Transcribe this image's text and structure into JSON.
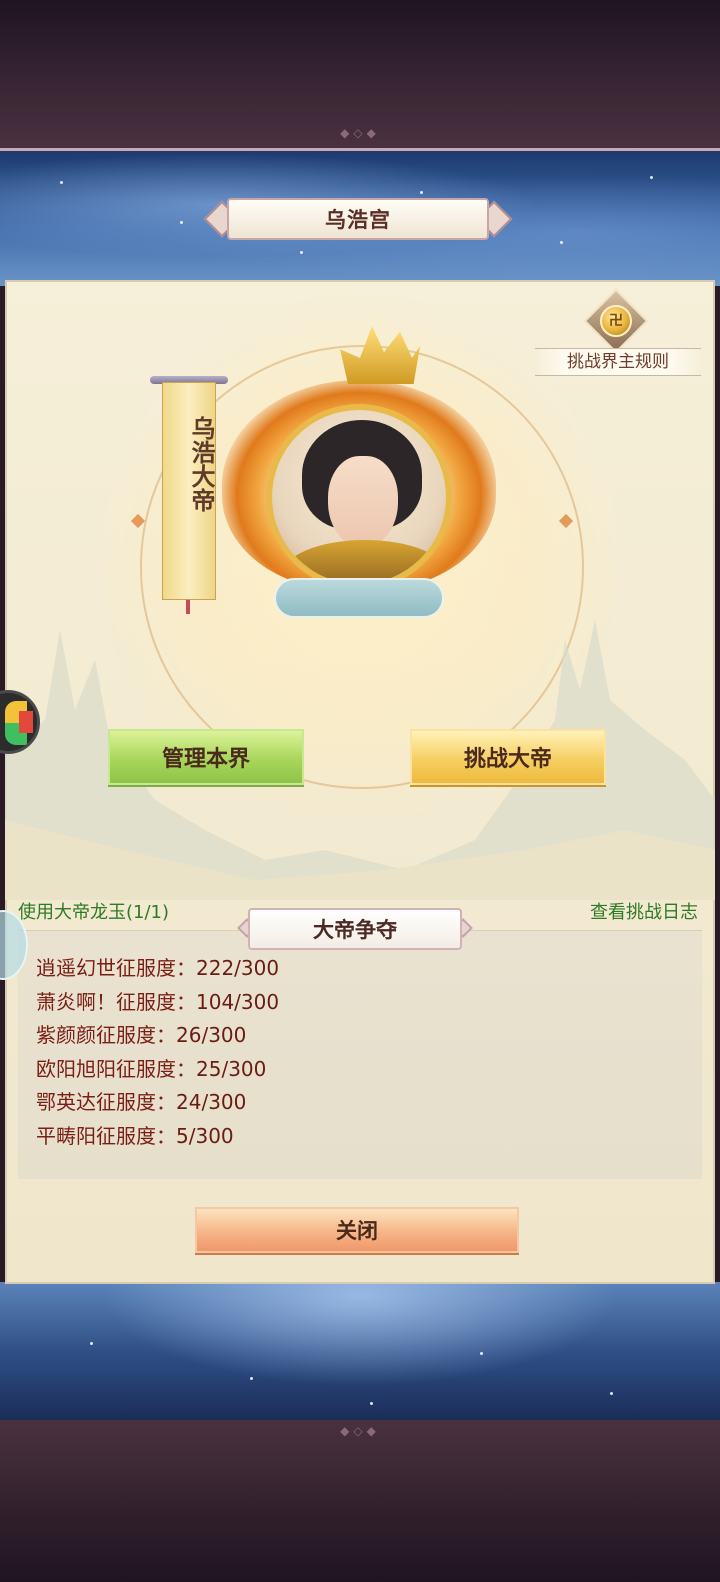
{
  "header": {
    "title": "乌浩宫"
  },
  "rules": {
    "label": "挑战界主规则",
    "icon": "scroll-coin-icon"
  },
  "emperor": {
    "name": "乌浩大帝"
  },
  "actions": {
    "manage_label": "管理本界",
    "challenge_label": "挑战大帝"
  },
  "links": {
    "jade_label": "使用大帝龙玉",
    "jade_count": "(1/1)",
    "log_label": "查看挑战日志"
  },
  "contest": {
    "title": "大帝争夺",
    "entries": [
      {
        "name": "逍遥幻世",
        "metric": "征服度：",
        "score": "222/300"
      },
      {
        "name": "萧炎啊！",
        "metric": "征服度：",
        "score": "104/300"
      },
      {
        "name": "紫颜颜",
        "metric": "征服度：",
        "score": "26/300"
      },
      {
        "name": "欧阳旭阳",
        "metric": "征服度：",
        "score": "25/300"
      },
      {
        "name": "鄂英达",
        "metric": "征服度：",
        "score": "24/300"
      },
      {
        "name": "平畴阳",
        "metric": "征服度：",
        "score": "5/300"
      }
    ]
  },
  "footer": {
    "close_label": "关闭"
  },
  "colors": {
    "manage_button": "#a8d65a",
    "challenge_button": "#f6cf62",
    "close_button": "#f7b98c",
    "link_green": "#2f7a26",
    "entry_red": "#7a1e14"
  }
}
